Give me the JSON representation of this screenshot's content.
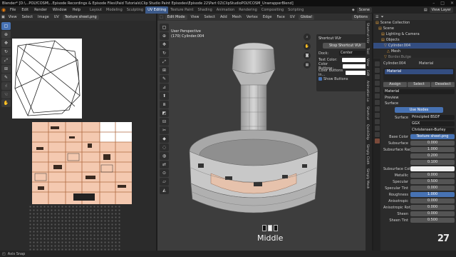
{
  "window": {
    "title": "Blender* [D:\\...POLYCOSM\\...Episode Recordings & Episode Files\\Paid Tutorials\\Clip Studio Paint Episodes\\Episode 22\\Part 02\\ClipStudioPOLYCOSM_UnwrapperBlend]",
    "controls": [
      "–",
      "□",
      "✕"
    ]
  },
  "menu": [
    "File",
    "Edit",
    "Render",
    "Window",
    "Help"
  ],
  "workspaces": [
    {
      "label": "Layout",
      "active": false
    },
    {
      "label": "Modeling",
      "active": false
    },
    {
      "label": "Sculpting",
      "active": false
    },
    {
      "label": "UV Editing",
      "active": true
    },
    {
      "label": "Texture Paint",
      "active": false
    },
    {
      "label": "Shading",
      "active": false
    },
    {
      "label": "Animation",
      "active": false
    },
    {
      "label": "Rendering",
      "active": false
    },
    {
      "label": "Compositing",
      "active": false
    },
    {
      "label": "Scripting",
      "active": false
    }
  ],
  "scene": {
    "label": "Scene",
    "view_layer": "View Layer"
  },
  "uv_editor": {
    "header": [
      "View",
      "Select",
      "Image",
      "UV"
    ],
    "image_name": "Texture sheet.png"
  },
  "viewport": {
    "mode": "Edit Mode",
    "header": [
      "View",
      "Select",
      "Add",
      "Mesh",
      "Vertex",
      "Edge",
      "Face",
      "UV"
    ],
    "orientation": "Global",
    "info_line1": "User Perspective",
    "info_line2": "(170) Cylinder.004",
    "options_label": "Options",
    "tabs": [
      "Shortcut VUr",
      "Tool",
      "View",
      "Edit",
      "Animation Lo",
      "Shortcut",
      "QuickDrip",
      "Simply Cloth",
      "Simply Mesh"
    ],
    "key_overlay": "Middle"
  },
  "shortcut_panel": {
    "title": "Shortcut VUr",
    "stop_button": "Stop Shortcut VUr",
    "dock_label": "Dock:",
    "dock_value": "Center",
    "text_color_label": "Text Color:",
    "buttons_label": "Color Buttons:",
    "buttons2_label": "Color Buttons in...",
    "show_buttons": "Show Buttons"
  },
  "outliner": {
    "rows": [
      {
        "label": "Scene Collection",
        "selected": false
      },
      {
        "label": "Scene",
        "selected": false
      },
      {
        "label": "Lighting & Camera",
        "selected": false
      },
      {
        "label": "Objects",
        "selected": false
      },
      {
        "label": "Cylinder.004",
        "selected": true
      },
      {
        "label": "Mesh",
        "selected": false
      },
      {
        "label": "Border.Bulge",
        "selected": false
      }
    ]
  },
  "properties": {
    "object_name": "Cylinder.004",
    "tab_label": "Material",
    "slot_name": "Material",
    "buttons": [
      "Assign",
      "Select",
      "Deselect"
    ],
    "material_name": "Material",
    "preview_label": "Preview",
    "surface_label": "Surface",
    "use_nodes": "Use Nodes",
    "surface_row": {
      "label": "Surface",
      "value": "Principled BSDF"
    },
    "distribution": "GGX",
    "subsurface_method": "Christensen-Burley",
    "rows": [
      {
        "label": "Base Color",
        "value": "Texture sheet.png",
        "style": "blue"
      },
      {
        "label": "Subsurface",
        "value": "0.000",
        "style": ""
      },
      {
        "label": "Subsurface Radi...",
        "value": "1.000",
        "style": ""
      },
      {
        "label": "",
        "value": "0.200",
        "style": ""
      },
      {
        "label": "",
        "value": "0.100",
        "style": ""
      },
      {
        "label": "Subsurface Color",
        "value": "",
        "style": "white"
      },
      {
        "label": "Metallic",
        "value": "0.000",
        "style": ""
      },
      {
        "label": "Specular",
        "value": "0.500",
        "style": ""
      },
      {
        "label": "Specular Tint",
        "value": "0.000",
        "style": ""
      },
      {
        "label": "Roughness",
        "value": "1.000",
        "style": "blue"
      },
      {
        "label": "Anisotropic",
        "value": "0.000",
        "style": ""
      },
      {
        "label": "Anisotropic Rot...",
        "value": "0.000",
        "style": ""
      },
      {
        "label": "Sheen",
        "value": "0.000",
        "style": ""
      },
      {
        "label": "Sheen Tint",
        "value": "0.500",
        "style": ""
      }
    ]
  },
  "status": {
    "left": "Axis Snap"
  },
  "watermark": "27"
}
